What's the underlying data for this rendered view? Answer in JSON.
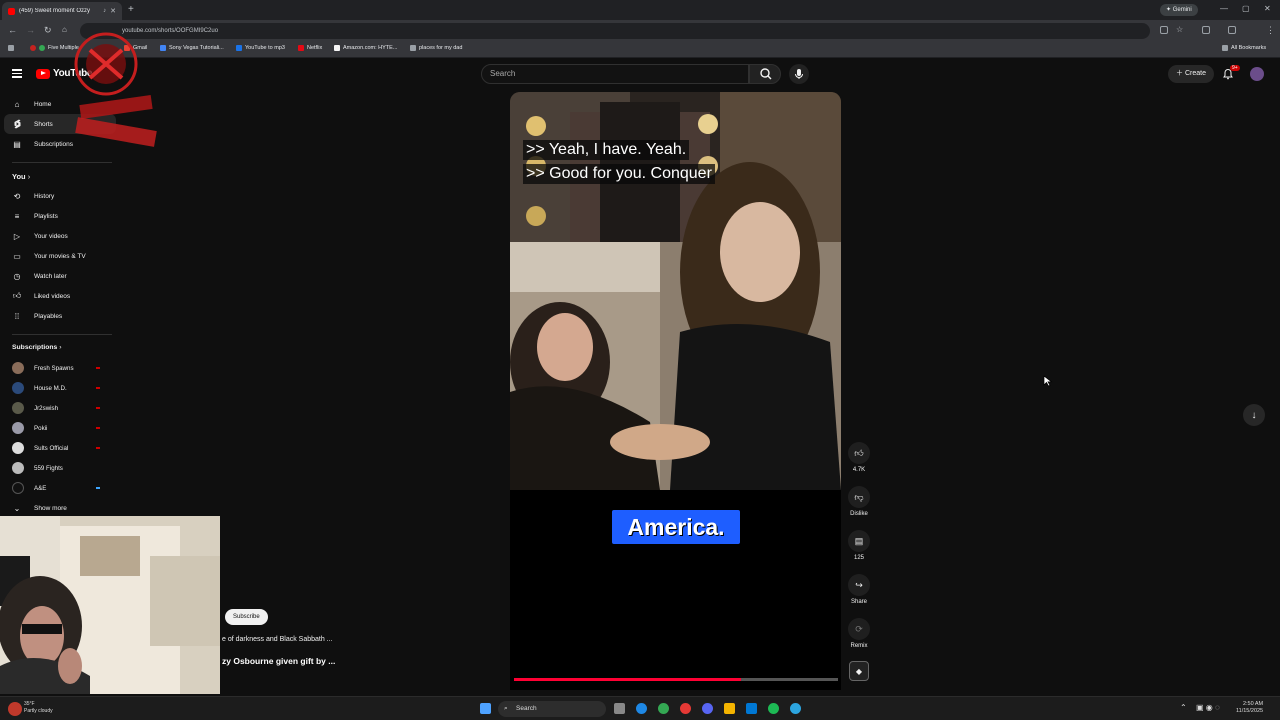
{
  "browser": {
    "tab_title": "(459) Sweet moment Ozzy",
    "gemini_label": "Gemini",
    "url": "youtube.com/shorts/OOFGMI9C2uo",
    "all_bookmarks": "All Bookmarks",
    "bookmarks": [
      "Five Multiple",
      "Gmail",
      "Sony Vegas Tutoriali...",
      "YouTube to mp3",
      "Netflix",
      "Amazon.com: HYTE...",
      "places for my dad"
    ]
  },
  "youtube": {
    "logo_text": "YouTube",
    "search_placeholder": "Search",
    "create_label": "Create",
    "notification_badge": "9+"
  },
  "sidebar": {
    "main": [
      {
        "label": "Home",
        "icon": "home-icon"
      },
      {
        "label": "Shorts",
        "icon": "shorts-icon"
      },
      {
        "label": "Subscriptions",
        "icon": "subscriptions-icon"
      }
    ],
    "you_header": "You",
    "you_items": [
      {
        "label": "History",
        "icon": "history-icon"
      },
      {
        "label": "Playlists",
        "icon": "playlists-icon"
      },
      {
        "label": "Your videos",
        "icon": "your-videos-icon"
      },
      {
        "label": "Your movies & TV",
        "icon": "movies-icon"
      },
      {
        "label": "Watch later",
        "icon": "watch-later-icon"
      },
      {
        "label": "Liked videos",
        "icon": "liked-icon"
      },
      {
        "label": "Playables",
        "icon": "playables-icon"
      }
    ],
    "subscriptions_header": "Subscriptions",
    "channels": [
      {
        "label": "Fresh Spawns",
        "color": "#8a6d5a"
      },
      {
        "label": "House M.D.",
        "color": "#2b4a7a"
      },
      {
        "label": "Jr2swish",
        "color": "#5a5a4a"
      },
      {
        "label": "Pokii",
        "color": "#9a9aa8"
      },
      {
        "label": "Sults Official",
        "color": "#ddd"
      },
      {
        "label": "559 Fights",
        "color": "#bbb"
      },
      {
        "label": "A&E",
        "color": "#111"
      }
    ],
    "show_more": "Show more"
  },
  "video": {
    "caption_line1": ">> Yeah, I have. Yeah.",
    "caption_line2": ">> Good for you. Conquer",
    "big_caption": "America.",
    "progress": 0.7
  },
  "actions": {
    "like_count": "4.7K",
    "dislike_label": "Dislike",
    "comment_count": "125",
    "share_label": "Share",
    "remix_label": "Remix"
  },
  "behind_webcam": {
    "subscribe_label": "Subscribe",
    "desc_fragment": "e of darkness and Black Sabbath ...",
    "title_fragment": "zy Osbourne given gift by ..."
  },
  "taskbar": {
    "search_label": "Search",
    "weather_temp": "35°F",
    "weather_desc": "Partly cloudy",
    "time": "2:50 AM",
    "date": "11/15/2025"
  }
}
